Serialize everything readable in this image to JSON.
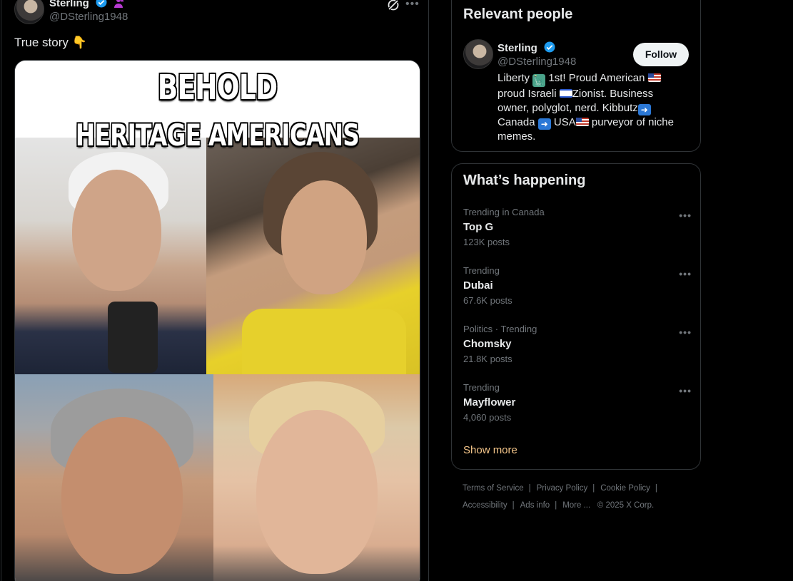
{
  "tweet": {
    "author_name": "Sterling",
    "handle": "@DSterling1948",
    "text": "True story 👇",
    "meme_line1": "BEHOLD",
    "meme_line2": "HERITAGE AMERICANS"
  },
  "relevant_people": {
    "title": "Relevant people",
    "name": "Sterling",
    "handle": "@DSterling1948",
    "follow_label": "Follow",
    "bio": {
      "p1": "Liberty",
      "p2": " 1st! Proud American ",
      "p3": " proud Israeli ",
      "p4": "Zionist. Business owner, polyglot, nerd. Kibbutz",
      "p5": " Canada ",
      "p6": " USA",
      "p7": " purveyor of niche memes."
    }
  },
  "whats_happening": {
    "title": "What’s happening",
    "trends": [
      {
        "meta": "Trending in Canada",
        "name": "Top G",
        "count": "123K posts"
      },
      {
        "meta": "Trending",
        "name": "Dubai",
        "count": "67.6K posts"
      },
      {
        "meta": "Politics · Trending",
        "name": "Chomsky",
        "count": "21.8K posts"
      },
      {
        "meta": "Trending",
        "name": "Mayflower",
        "count": "4,060 posts"
      }
    ],
    "show_more": "Show more"
  },
  "footer": {
    "terms": "Terms of Service",
    "privacy": "Privacy Policy",
    "cookie": "Cookie Policy",
    "accessibility": "Accessibility",
    "ads": "Ads info",
    "more": "More ...",
    "copyright": "© 2025 X Corp.",
    "sep": "|"
  },
  "colors": {
    "background": "#000000",
    "text": "#e7e9ea",
    "muted": "#71767b",
    "verified": "#1d9bf0",
    "show_more": "#f5c68a"
  },
  "icons": [
    "verified-badge-icon",
    "affiliate-badge-icon",
    "grok-icon",
    "more-icon",
    "pointing-down-emoji"
  ]
}
